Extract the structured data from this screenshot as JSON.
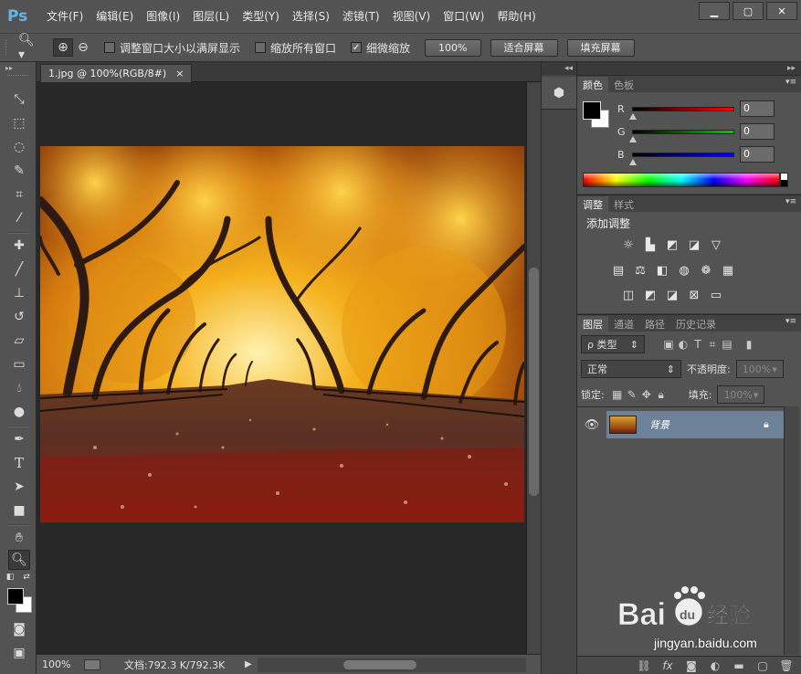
{
  "app": {
    "logo": "Ps",
    "menu": [
      "文件(F)",
      "编辑(E)",
      "图像(I)",
      "图层(L)",
      "类型(Y)",
      "选择(S)",
      "滤镜(T)",
      "视图(V)",
      "窗口(W)",
      "帮助(H)"
    ],
    "window_controls": [
      "minimize",
      "restore",
      "close"
    ]
  },
  "options": {
    "tool_icon": "zoom-tool-icon",
    "resize_windows": {
      "label": "调整窗口大小以满屏显示",
      "checked": false
    },
    "zoom_all": {
      "label": "缩放所有窗口",
      "checked": false
    },
    "scrubby": {
      "label": "细微缩放",
      "checked": true
    },
    "btn_100": "100%",
    "btn_fit": "适合屏幕",
    "btn_fill": "填充屏幕"
  },
  "document": {
    "tab_title": "1.jpg @ 100%(RGB/8#)",
    "tab_close": "×",
    "zoom": "100%",
    "doc_info": "文档:792.3 K/792.3K",
    "photo_description_icon": "autumn-tree-avenue-photo"
  },
  "color_panel": {
    "tabs": [
      "颜色",
      "色板"
    ],
    "sliders": [
      {
        "label": "R",
        "value": "0",
        "color": "#ff0000"
      },
      {
        "label": "G",
        "value": "0",
        "color": "#00cc00"
      },
      {
        "label": "B",
        "value": "0",
        "color": "#0000ff"
      }
    ],
    "foreground": "#000000",
    "background": "#ffffff"
  },
  "adjustments_panel": {
    "tabs": [
      "调整",
      "样式"
    ],
    "title": "添加调整"
  },
  "layers_panel": {
    "tabs": [
      "图层",
      "通道",
      "路径",
      "历史记录"
    ],
    "filter_label": "ρ 类型",
    "blend_mode": "正常",
    "opacity_label": "不透明度:",
    "opacity_value": "100%",
    "lock_label": "锁定:",
    "fill_label": "填充:",
    "fill_value": "100%",
    "layer_name": "背景"
  },
  "watermark": {
    "text": "jingyan.baidu.com"
  }
}
